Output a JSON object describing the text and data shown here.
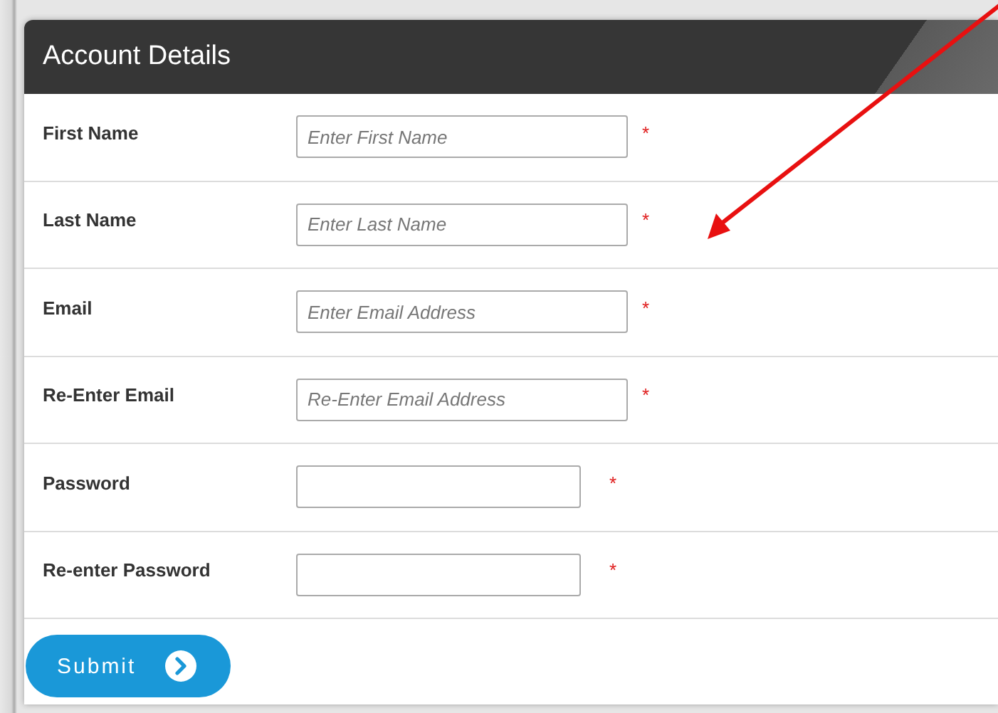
{
  "panel": {
    "title": "Account Details"
  },
  "fields": [
    {
      "label": "First Name",
      "kind": "text",
      "placeholder": "Enter First Name",
      "required": true
    },
    {
      "label": "Last Name",
      "kind": "text",
      "placeholder": "Enter Last Name",
      "required": true
    },
    {
      "label": "Email",
      "kind": "text",
      "placeholder": "Enter Email Address",
      "required": true
    },
    {
      "label": "Re-Enter Email",
      "kind": "text",
      "placeholder": "Re-Enter Email Address",
      "required": true
    },
    {
      "label": "Password",
      "kind": "password",
      "required": true
    },
    {
      "label": "Re-enter Password",
      "kind": "password",
      "required": true
    }
  ],
  "required_mark": "*",
  "submit": {
    "label": "Submit"
  }
}
